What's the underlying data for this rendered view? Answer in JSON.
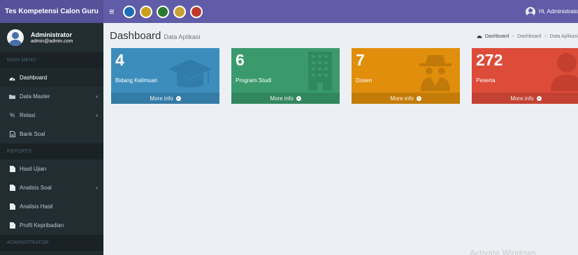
{
  "app": {
    "title": "Tes Kompetensi Calon Guru"
  },
  "navbar": {
    "logos": [
      "#1f6fb8",
      "#caa11f",
      "#2c7a2f",
      "#c9a034",
      "#c0392b"
    ],
    "user_greeting": "Hi, Administrato"
  },
  "sidebar": {
    "user": {
      "name": "Administrator",
      "email": "admin@admin.com"
    },
    "sections": {
      "main": "MAIN MENU",
      "reports": "REPORTS",
      "admin": "ADMINISTRATOR"
    },
    "items": [
      {
        "label": "Dashboard",
        "icon": "dashboard-icon",
        "active": true
      },
      {
        "label": "Data Master",
        "icon": "folder-icon",
        "has_submenu": true
      },
      {
        "label": "Relasi",
        "icon": "percent-icon",
        "has_submenu": true
      },
      {
        "label": "Bank Soal",
        "icon": "file-icon"
      },
      {
        "label": "Hasil Ujian",
        "icon": "file-icon"
      },
      {
        "label": "Analisis Soal",
        "icon": "file-icon",
        "has_submenu": true
      },
      {
        "label": "Analisis Hasil",
        "icon": "file-icon"
      },
      {
        "label": "Profil Kepribadian",
        "icon": "file-icon"
      }
    ]
  },
  "page": {
    "title": "Dashboard",
    "subtitle": "Data Aplikasi",
    "breadcrumb": [
      "Dashboard",
      "Dashboard",
      "Data Aplikasi"
    ]
  },
  "stats": [
    {
      "value": "4",
      "label": "Bidang Keilmuan",
      "color": "#3c8dbc",
      "icon": "graduation-cap-icon",
      "more": "More info"
    },
    {
      "value": "6",
      "label": "Program Studi",
      "color": "#3a9a6c",
      "icon": "building-icon",
      "more": "More info"
    },
    {
      "value": "7",
      "label": "Dosen",
      "color": "#e08e0b",
      "icon": "spy-icon",
      "more": "More info"
    },
    {
      "value": "272",
      "label": "Peserta",
      "color": "#dd4b39",
      "icon": "user-icon",
      "more": "More info"
    }
  ],
  "watermark": "Activate Windows"
}
